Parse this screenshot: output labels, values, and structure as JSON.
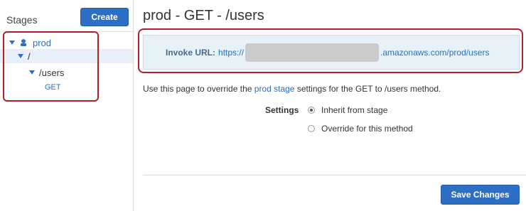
{
  "sidebar": {
    "title": "Stages",
    "create_label": "Create",
    "tree": {
      "stage": "prod",
      "root_resource": "/",
      "resource": "/users",
      "method": "GET"
    }
  },
  "main": {
    "title": "prod - GET - /users",
    "invoke": {
      "label": "Invoke URL:",
      "url_prefix": "https://",
      "url_suffix": ".amazonaws.com/prod/users"
    },
    "description": {
      "before": "Use this page to override the ",
      "link": "prod stage",
      "after": " settings for the GET to /users method."
    },
    "settings": {
      "label": "Settings",
      "options": [
        {
          "label": "Inherit from stage",
          "selected": true
        },
        {
          "label": "Override for this method",
          "selected": false
        }
      ]
    },
    "save_label": "Save Changes"
  },
  "colors": {
    "accent": "#2e6fc6",
    "highlight": "#b0212c",
    "panel": "#e6f1f8"
  }
}
